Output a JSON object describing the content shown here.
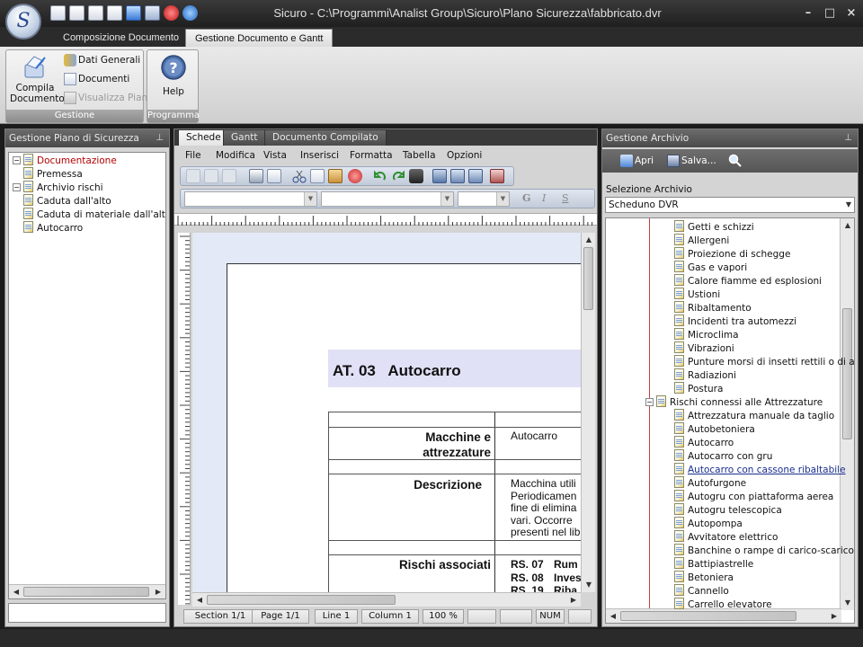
{
  "window": {
    "title": "Sicuro - C:\\Programmi\\Analist Group\\Sicuro\\Plano Sicurezza\\fabbricato.dvr",
    "logo_letter": "S",
    "minimize": "–",
    "maximize": "□",
    "close": "×"
  },
  "ribbon_tabs": [
    "Composizione Documento",
    "Gestione Documento e Gantt"
  ],
  "ribbon": {
    "compila_label": "Compila\nDocumento",
    "dati_generali": "Dati Generali",
    "documenti": "Documenti",
    "visualizza_piano": "Visualizza Piano",
    "gestione_group": "Gestione",
    "help_label": "Help",
    "programma_group": "Programma"
  },
  "left_pane": {
    "title": "Gestione Piano di Sicurezza",
    "tree": [
      {
        "label": "Documentazione",
        "level": 0,
        "color": "#b00000"
      },
      {
        "label": "Premessa",
        "level": 1,
        "color": "#111111"
      },
      {
        "label": "Archivio rischi",
        "level": 0,
        "color": "#111111"
      },
      {
        "label": "Caduta dall'alto",
        "level": 1,
        "color": "#111111"
      },
      {
        "label": "Caduta di materiale dall'alto",
        "level": 1,
        "color": "#111111"
      },
      {
        "label": "Autocarro",
        "level": 1,
        "color": "#111111"
      }
    ]
  },
  "editor": {
    "tabs": [
      "Schede",
      "Gantt",
      "Documento Compilato"
    ],
    "menu": [
      "File",
      "Modifica",
      "Vista",
      "Inserisci",
      "Formatta",
      "Tabella",
      "Opzioni"
    ],
    "format_buttons": [
      "G",
      "I",
      "S"
    ],
    "doc": {
      "heading": "AT. 03   Autocarro",
      "row1_label": "Macchine e attrezzature",
      "row1_value": "Autocarro",
      "row2_label": "Descrizione",
      "row2_value_lines": [
        "Macchina utili",
        "Periodicamen",
        "fine di elimina",
        "vari. Occorre",
        "presenti nel lib"
      ],
      "row3_label": "Rischi associati",
      "risks": [
        {
          "code": "RS. 07",
          "text": "Rum"
        },
        {
          "code": "RS. 08",
          "text": "Inves"
        },
        {
          "code": "RS. 19",
          "text": "Riba"
        }
      ]
    },
    "status": {
      "section": "Section 1/1",
      "page": "Page 1/1",
      "line": "Line 1",
      "column": "Column 1",
      "zoom": "100 %",
      "num": "NUM"
    }
  },
  "right_pane": {
    "title": "Gestione Archivio",
    "apri": "Apri",
    "salva": "Salva...",
    "selezione_label": "Selezione Archivio",
    "selezione_value": "Scheduno DVR",
    "tree": [
      {
        "label": "Getti e schizzi",
        "level": 2
      },
      {
        "label": "Allergeni",
        "level": 2
      },
      {
        "label": "Proiezione di schegge",
        "level": 2
      },
      {
        "label": "Gas e vapori",
        "level": 2
      },
      {
        "label": "Calore fiamme ed esplosioni",
        "level": 2
      },
      {
        "label": "Ustioni",
        "level": 2
      },
      {
        "label": "Ribaltamento",
        "level": 2
      },
      {
        "label": "Incidenti tra automezzi",
        "level": 2
      },
      {
        "label": "Microclima",
        "level": 2
      },
      {
        "label": "Vibrazioni",
        "level": 2
      },
      {
        "label": "Punture morsi di insetti rettili o di altr",
        "level": 2
      },
      {
        "label": "Radiazioni",
        "level": 2
      },
      {
        "label": "Postura",
        "level": 2
      },
      {
        "label": "Rischi connessi alle Attrezzature",
        "level": 1
      },
      {
        "label": "Attrezzatura manuale da taglio",
        "level": 2
      },
      {
        "label": "Autobetoniera",
        "level": 2
      },
      {
        "label": "Autocarro",
        "level": 2
      },
      {
        "label": "Autocarro con gru",
        "level": 2
      },
      {
        "label": "Autocarro con cassone ribaltabile",
        "level": 2,
        "hover": true
      },
      {
        "label": "Autofurgone",
        "level": 2
      },
      {
        "label": "Autogru con piattaforma aerea",
        "level": 2
      },
      {
        "label": "Autogru telescopica",
        "level": 2
      },
      {
        "label": "Autopompa",
        "level": 2
      },
      {
        "label": "Avvitatore elettrico",
        "level": 2
      },
      {
        "label": "Banchine o rampe di carico-scarico",
        "level": 2
      },
      {
        "label": "Battipiastrelle",
        "level": 2
      },
      {
        "label": "Betoniera",
        "level": 2
      },
      {
        "label": "Cannello",
        "level": 2
      },
      {
        "label": "Carrello elevatore",
        "level": 2
      }
    ]
  },
  "colors": {
    "accent_red": "#b00000",
    "heading_band": "#e0e0f6",
    "link_blue": "#1a2f8f"
  }
}
